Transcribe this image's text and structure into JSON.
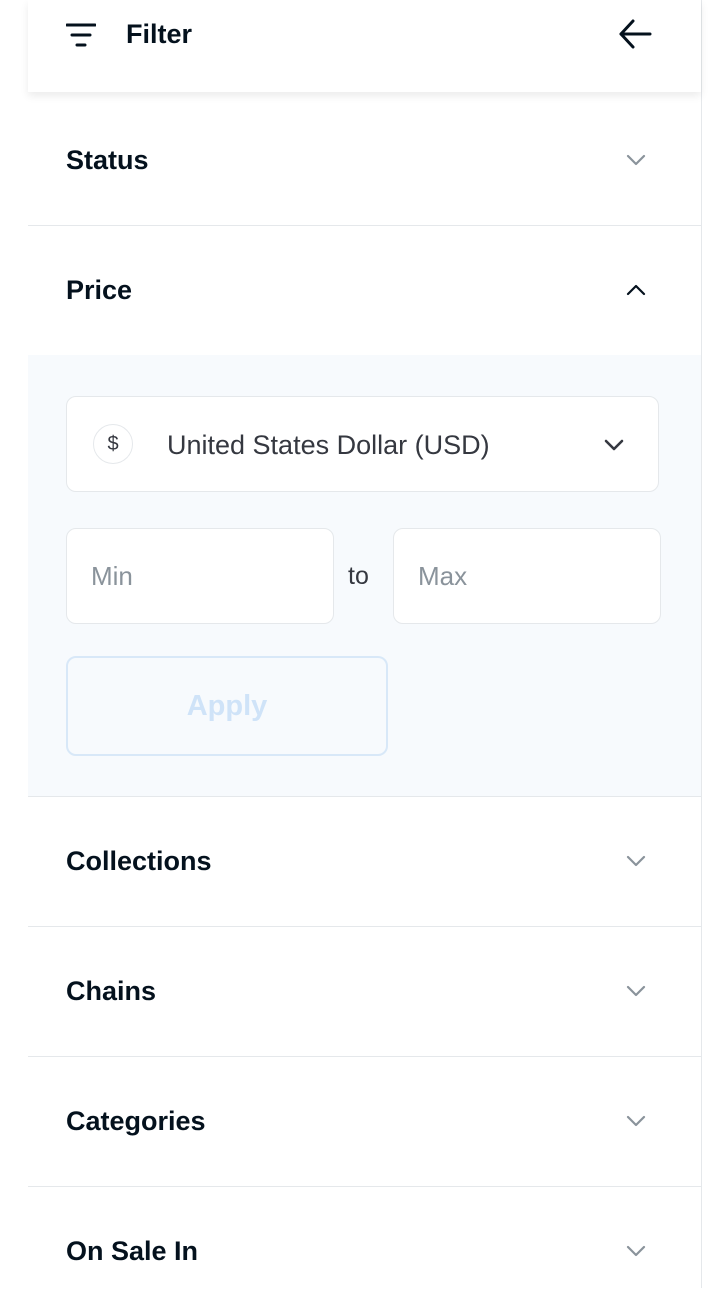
{
  "header": {
    "title": "Filter",
    "filter_icon": "filter-lines-icon",
    "back_icon": "arrow-left-icon"
  },
  "sections": {
    "status": {
      "label": "Status",
      "expanded": false
    },
    "price": {
      "label": "Price",
      "expanded": true
    },
    "collections": {
      "label": "Collections",
      "expanded": false
    },
    "chains": {
      "label": "Chains",
      "expanded": false
    },
    "categories": {
      "label": "Categories",
      "expanded": false
    },
    "on_sale_in": {
      "label": "On Sale In",
      "expanded": false
    }
  },
  "price": {
    "currency_symbol": "$",
    "currency_label": "United States Dollar (USD)",
    "min_value": "",
    "min_placeholder": "Min",
    "to_label": "to",
    "max_value": "",
    "max_placeholder": "Max",
    "apply_label": "Apply",
    "apply_enabled": false
  },
  "colors": {
    "text": "#04111d",
    "border": "#e5e8eb",
    "expanded_background": "#f7fafd",
    "apply_disabled_text": "#cfe3f8"
  }
}
